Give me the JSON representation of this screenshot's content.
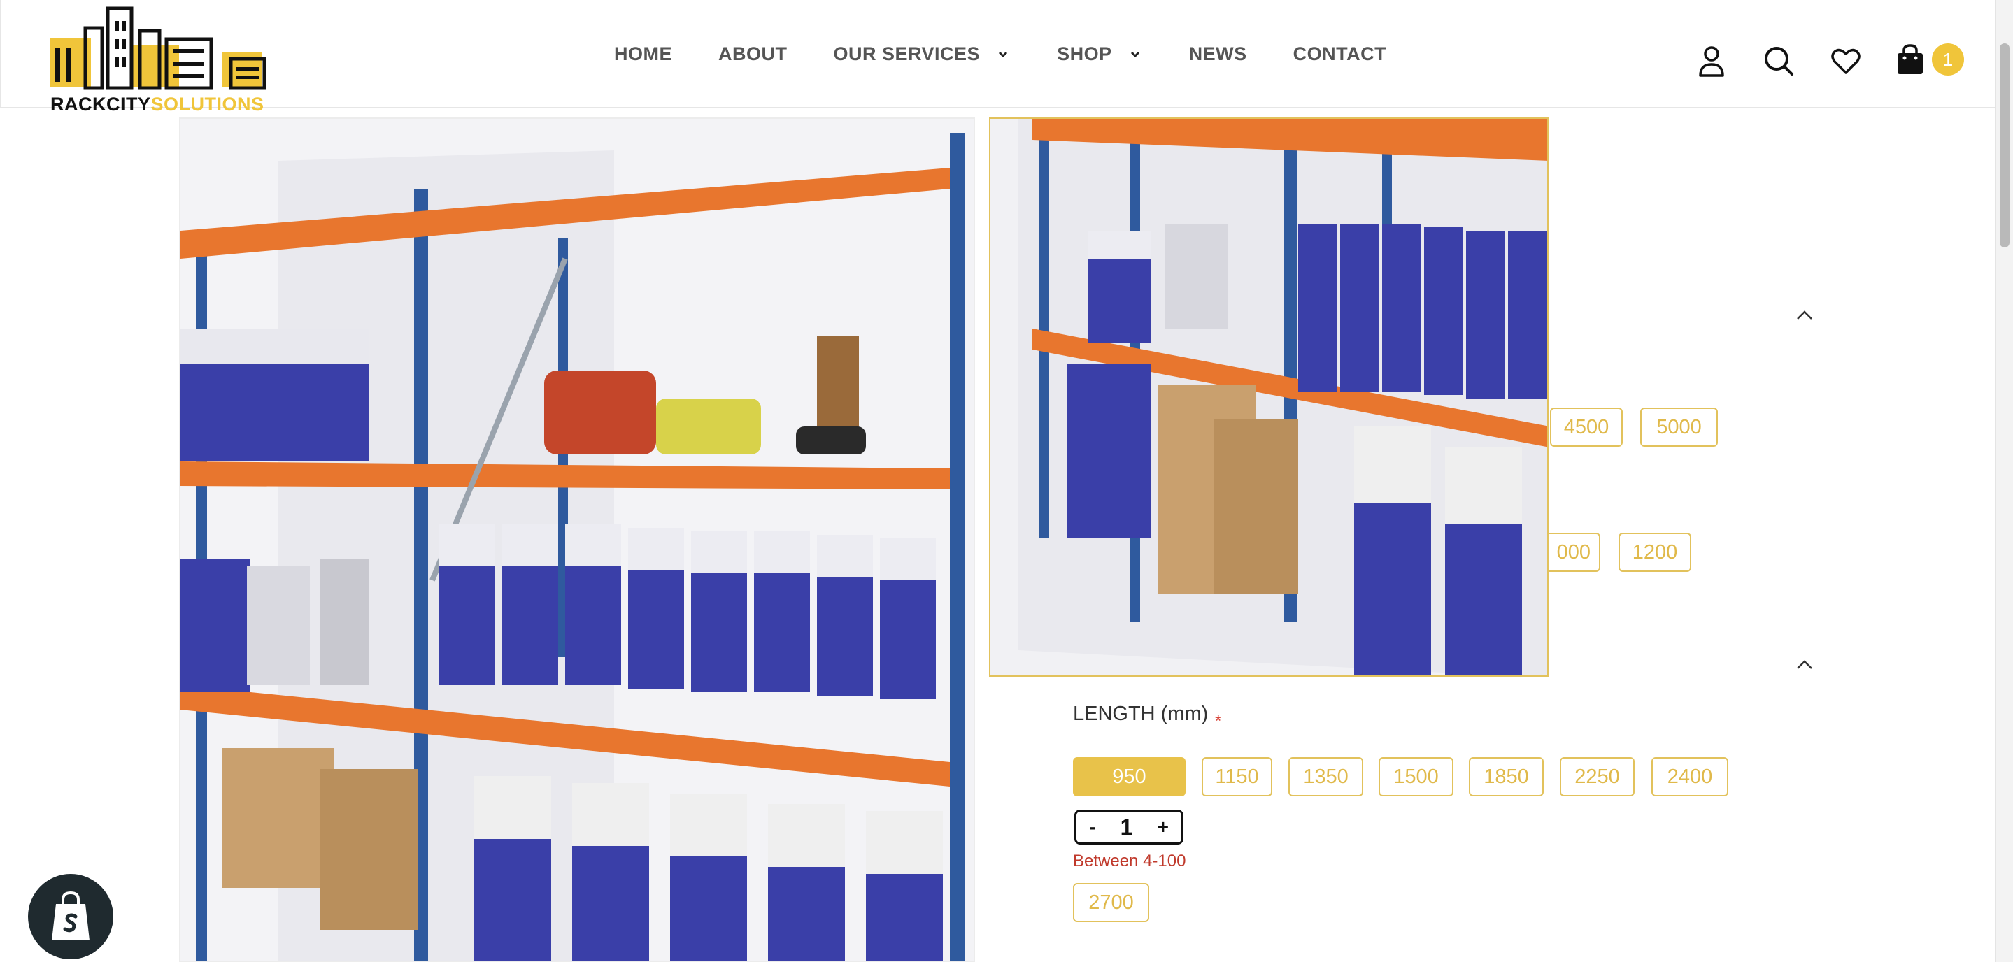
{
  "brand": {
    "name_part1": "RACKCITY",
    "name_part2": "SOLUTIONS",
    "accent_color": "#f0c53a"
  },
  "nav": {
    "items": [
      {
        "label": "HOME",
        "has_dropdown": false
      },
      {
        "label": "ABOUT",
        "has_dropdown": false
      },
      {
        "label": "OUR SERVICES",
        "has_dropdown": true
      },
      {
        "label": "SHOP",
        "has_dropdown": true
      },
      {
        "label": "NEWS",
        "has_dropdown": false
      },
      {
        "label": "CONTACT",
        "has_dropdown": false
      }
    ]
  },
  "header_icons": {
    "account": "user-icon",
    "search": "search-icon",
    "wishlist": "heart-icon",
    "cart": "shopping-bag-icon",
    "cart_count": "1"
  },
  "options": {
    "height_partial": [
      "4500",
      "5000"
    ],
    "depth_partial": [
      "000",
      "1200"
    ],
    "length_label": "LENGTH (mm)",
    "required_marker": "*",
    "length_values": [
      "950",
      "1150",
      "1350",
      "1500",
      "1850",
      "2250",
      "2400",
      "2700"
    ],
    "length_selected": "950"
  },
  "quantity": {
    "minus": "-",
    "value": "1",
    "plus": "+",
    "hint": "Between 4-100"
  },
  "colors": {
    "selected_option_bg": "#e8c24a",
    "rack_upright": "#2f5a9e",
    "rack_beam": "#e8762e",
    "error_text": "#c0392b"
  }
}
